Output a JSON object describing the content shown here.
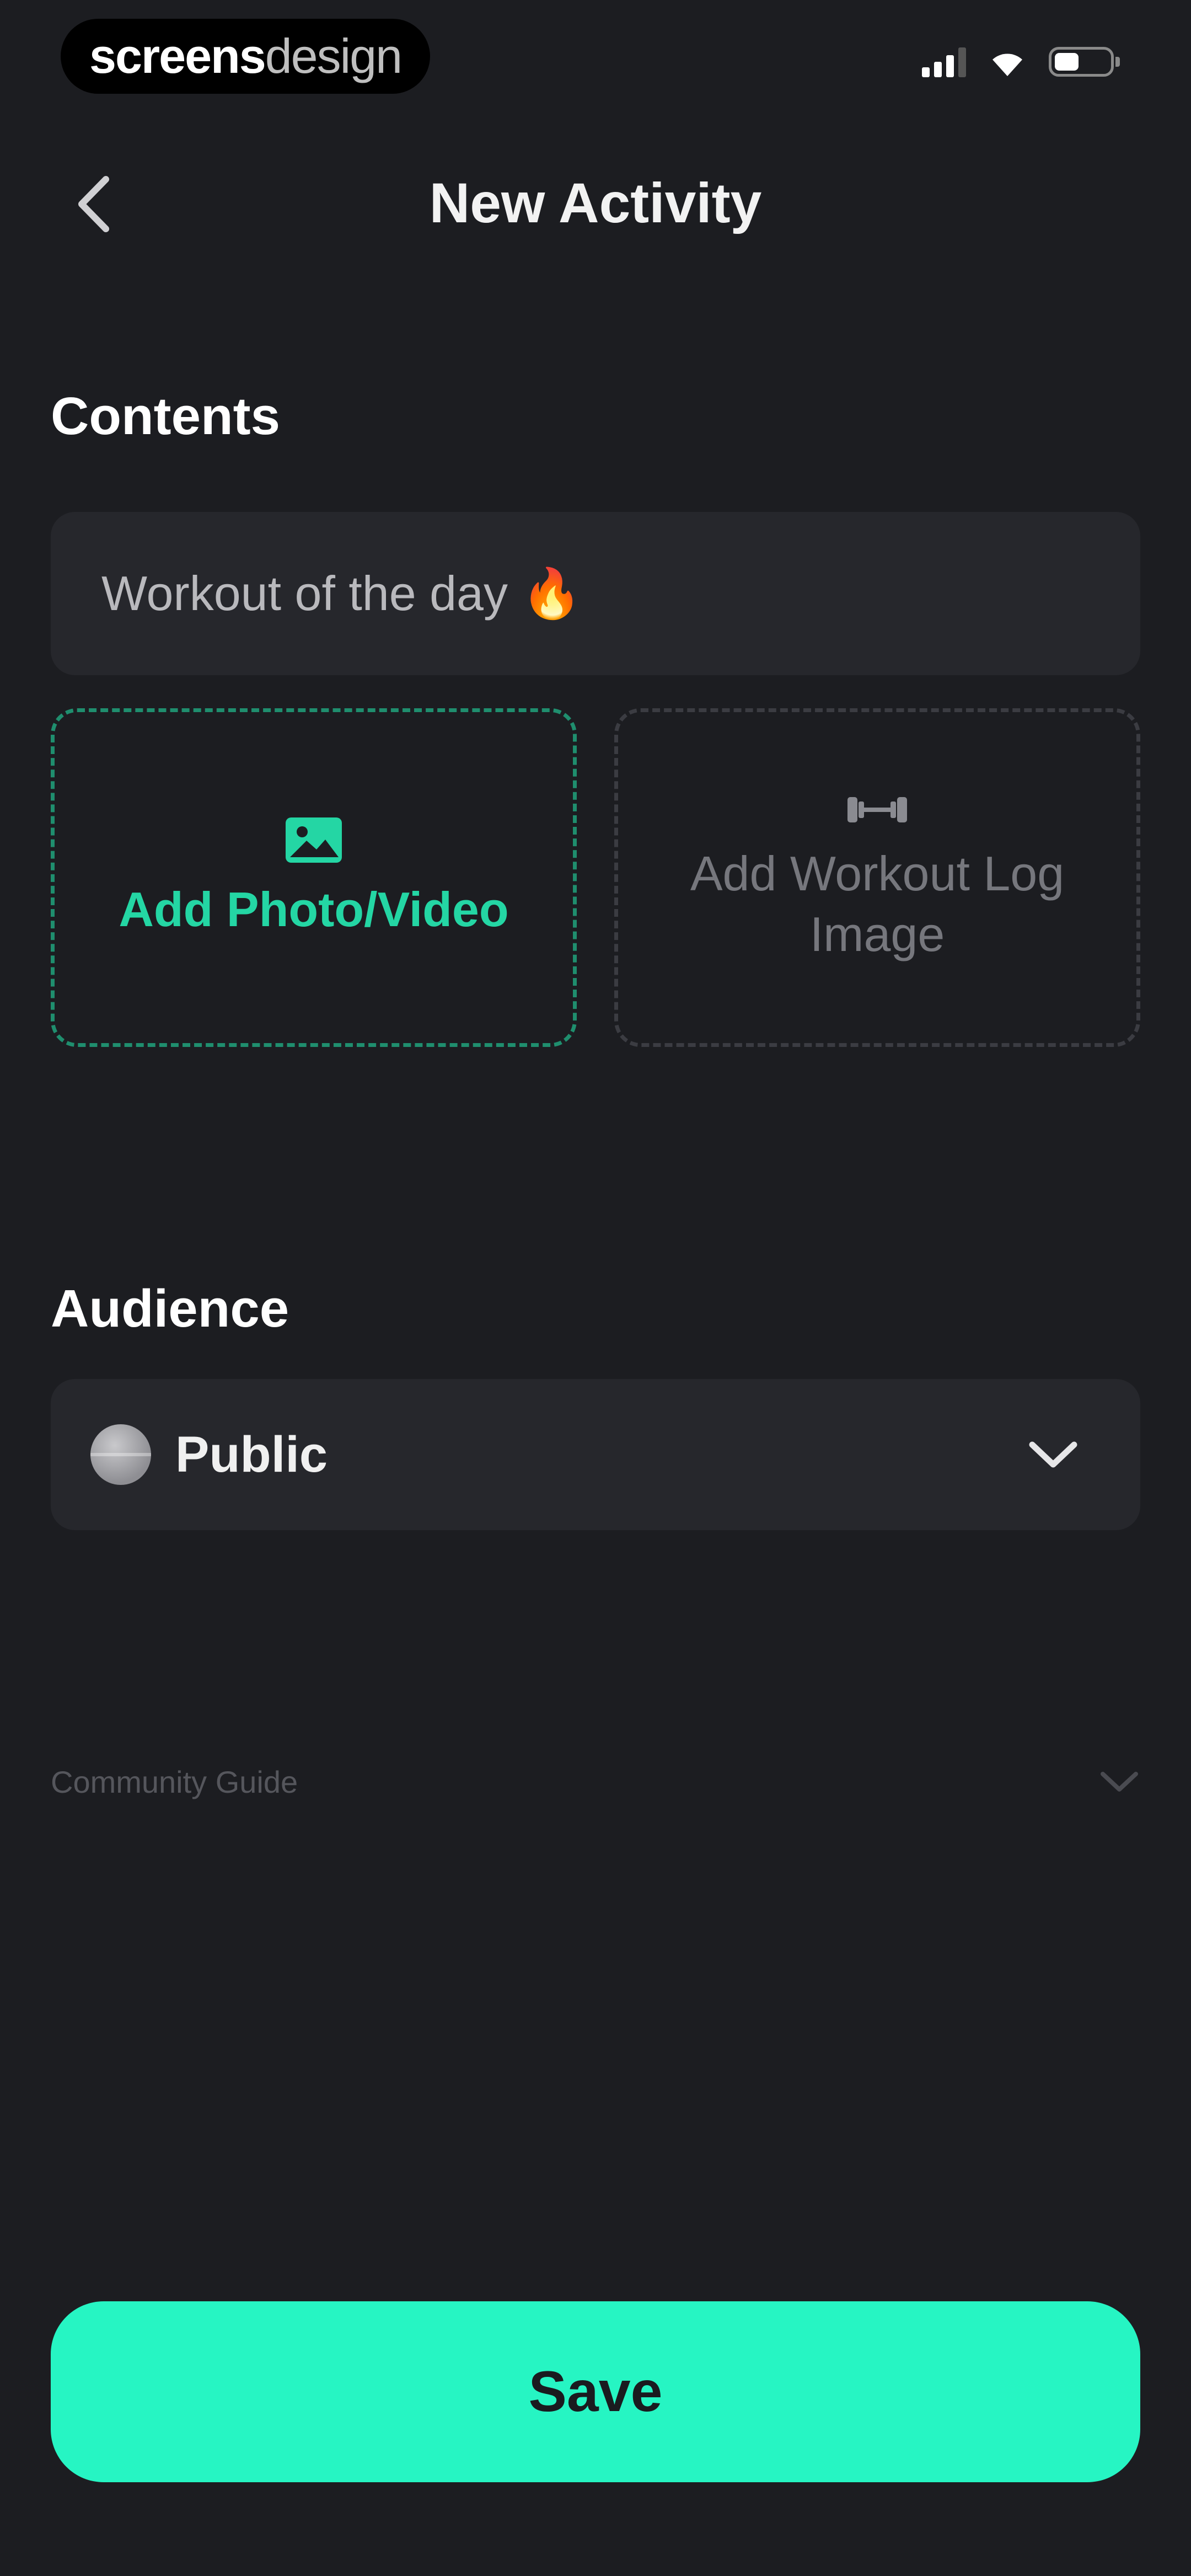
{
  "status_bar": {
    "watermark_bold": "screens",
    "watermark_thin": "design",
    "icons": [
      "signal-icon",
      "wifi-icon",
      "battery-icon"
    ]
  },
  "header": {
    "back_icon": "chevron-left-icon",
    "title": "New Activity"
  },
  "contents": {
    "title": "Contents",
    "text_value": "Workout of the day 🔥",
    "photo_tile": {
      "icon": "image-icon",
      "label": "Add Photo/Video"
    },
    "log_tile": {
      "icon": "dumbbell-icon",
      "label": "Add Workout Log Image"
    }
  },
  "audience": {
    "title": "Audience",
    "icon": "globe-icon",
    "selected": "Public"
  },
  "community_guide": {
    "label": "Community Guide",
    "icon": "chevron-down-icon"
  },
  "actions": {
    "save_label": "Save"
  },
  "colors": {
    "background": "#1c1d21",
    "field": "#26272c",
    "accent": "#26f5c3",
    "accent_text": "#24d6a4"
  }
}
